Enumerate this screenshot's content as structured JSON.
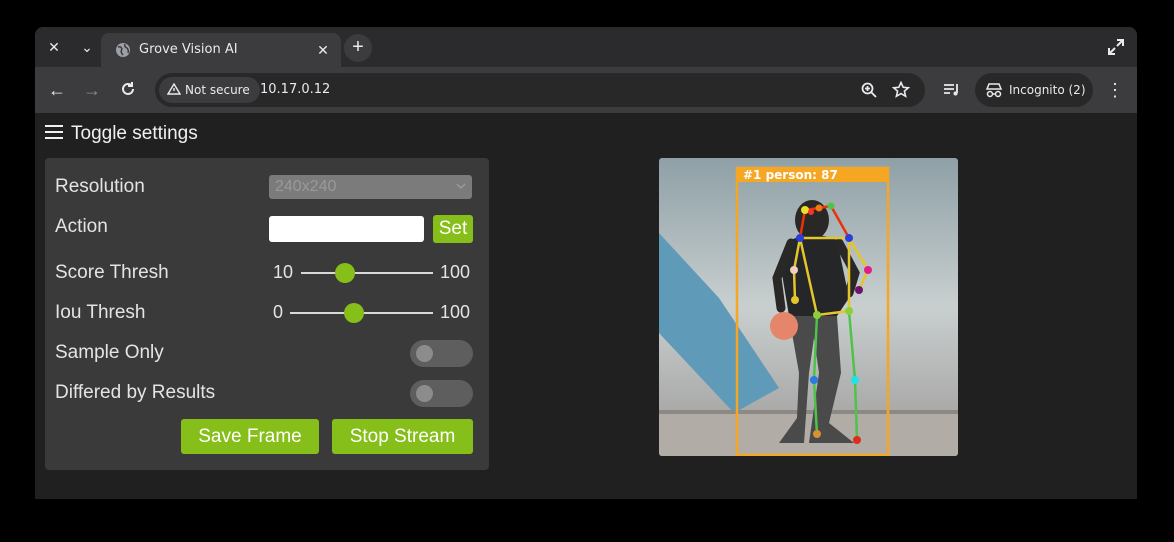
{
  "browser": {
    "tab_title": "Grove Vision AI",
    "security_label": "Not secure",
    "url": "10.17.0.12",
    "incognito_label": "Incognito (2)"
  },
  "page": {
    "toggle_label": "Toggle settings",
    "resolution": {
      "label": "Resolution",
      "value": "240x240"
    },
    "action": {
      "label": "Action",
      "value": "",
      "button": "Set"
    },
    "score_thresh": {
      "label": "Score Thresh",
      "min": "10",
      "max": "100",
      "value": 40
    },
    "iou_thresh": {
      "label": "Iou Thresh",
      "min": "0",
      "max": "100",
      "value": 45
    },
    "sample_only": {
      "label": "Sample Only",
      "on": false
    },
    "differed_by_results": {
      "label": "Differed by Results",
      "on": false
    },
    "save_button": "Save Frame",
    "stop_button": "Stop Stream"
  },
  "detection": {
    "label": "#1 person: 87",
    "box_color": "#f5a623"
  },
  "colors": {
    "accent": "#86be1a"
  }
}
